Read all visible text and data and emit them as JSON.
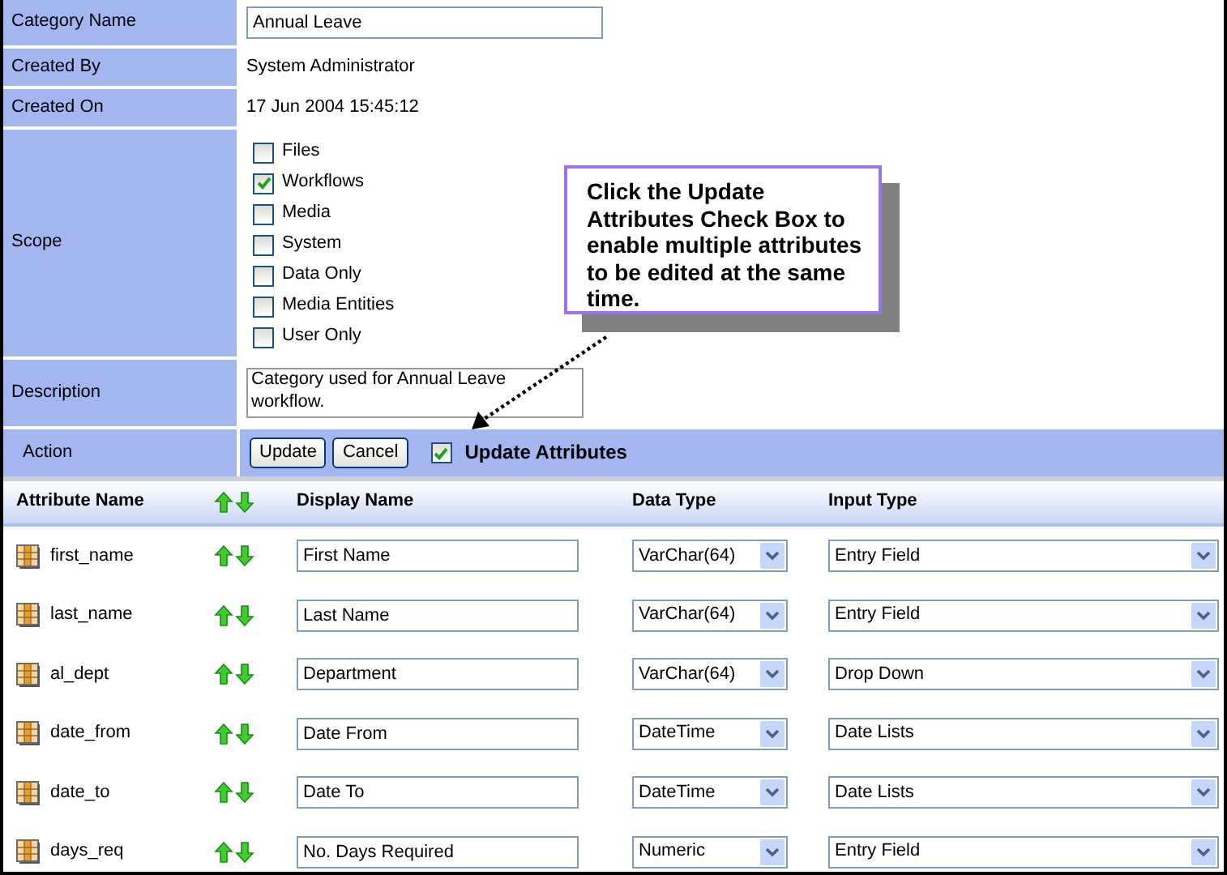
{
  "form": {
    "fields": [
      {
        "label": "Category Name",
        "kind": "input",
        "value": "Annual Leave"
      },
      {
        "label": "Created By",
        "kind": "text",
        "value": "System Administrator"
      },
      {
        "label": "Created On",
        "kind": "text",
        "value": "17 Jun 2004 15:45:12"
      },
      {
        "label": "Scope",
        "kind": "checklist",
        "options": [
          {
            "label": "Files",
            "checked": false
          },
          {
            "label": "Workflows",
            "checked": true
          },
          {
            "label": "Media",
            "checked": false
          },
          {
            "label": "System",
            "checked": false
          },
          {
            "label": "Data Only",
            "checked": false
          },
          {
            "label": "Media Entities",
            "checked": false
          },
          {
            "label": "User Only",
            "checked": false
          }
        ]
      },
      {
        "label": "Description",
        "kind": "textarea",
        "value": "Category used for Annual Leave workflow."
      }
    ],
    "action": {
      "label": "Action",
      "buttons": [
        "Update",
        "Cancel"
      ],
      "update_attributes": {
        "label": "Update Attributes",
        "checked": true
      }
    }
  },
  "callout": {
    "text": "Click the Update Attributes Check Box to enable multiple attributes to be edited at the same time."
  },
  "table": {
    "columns": [
      "Attribute Name",
      "Display Name",
      "Data Type",
      "Input Type"
    ],
    "rows": [
      {
        "attribute": "first_name",
        "display_name": "First Name",
        "data_type": "VarChar(64)",
        "input_type": "Entry Field"
      },
      {
        "attribute": "last_name",
        "display_name": "Last Name",
        "data_type": "VarChar(64)",
        "input_type": "Entry Field"
      },
      {
        "attribute": "al_dept",
        "display_name": "Department",
        "data_type": "VarChar(64)",
        "input_type": "Drop Down"
      },
      {
        "attribute": "date_from",
        "display_name": "Date From",
        "data_type": "DateTime",
        "input_type": "Date Lists"
      },
      {
        "attribute": "date_to",
        "display_name": "Date To",
        "data_type": "DateTime",
        "input_type": "Date Lists"
      },
      {
        "attribute": "days_req",
        "display_name": "No. Days Required",
        "data_type": "Numeric",
        "input_type": "Entry Field"
      }
    ]
  }
}
